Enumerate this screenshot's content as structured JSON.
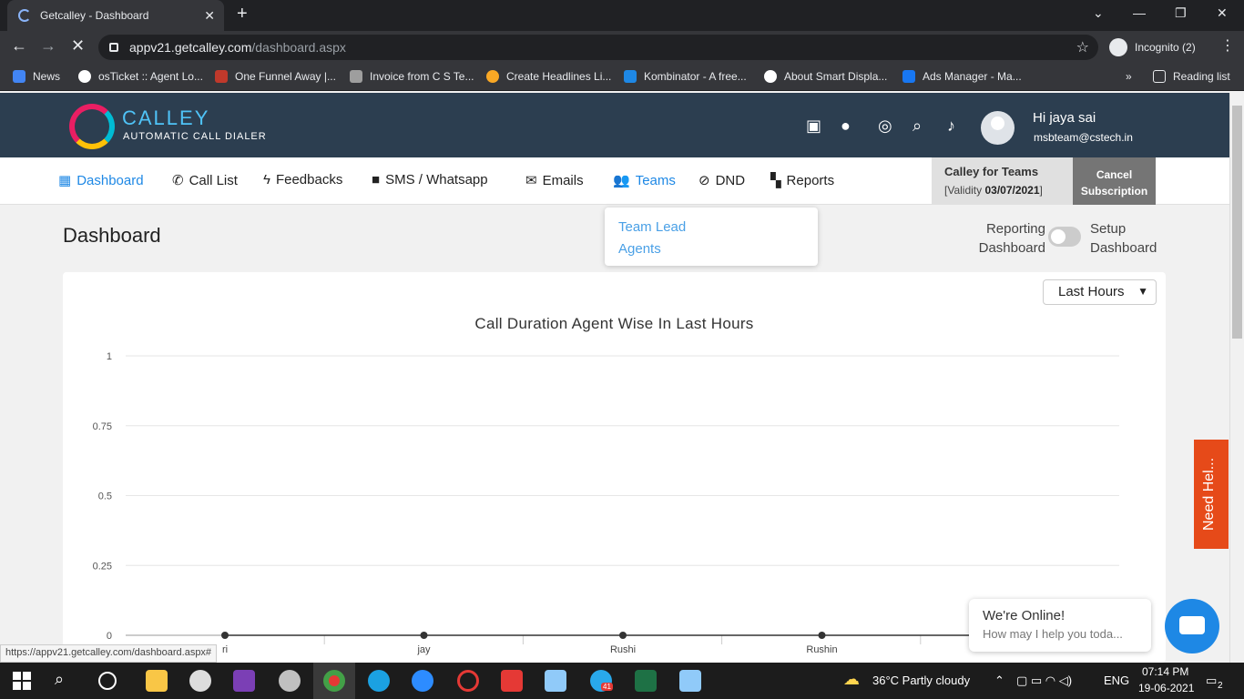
{
  "browser": {
    "tab_title": "Getcalley - Dashboard",
    "tab_close": "✕",
    "new_tab": "+",
    "url_host": "appv21.getcalley.com",
    "url_path": "/dashboard.aspx",
    "incognito_label": "Incognito (2)",
    "status_url": "https://appv21.getcalley.com/dashboard.aspx#"
  },
  "bookmarks": [
    {
      "label": "News",
      "color": "#4285f4"
    },
    {
      "label": "osTicket :: Agent Lo...",
      "color": "#ffffff"
    },
    {
      "label": "One Funnel Away |...",
      "color": "#c0392b"
    },
    {
      "label": "Invoice from C S Te...",
      "color": "#9e9e9e"
    },
    {
      "label": "Create Headlines Li...",
      "color": "#f9a825"
    },
    {
      "label": "Kombinator - A free...",
      "color": "#1e88e5"
    },
    {
      "label": "About Smart Displa...",
      "color": "#ffffff"
    },
    {
      "label": "Ads Manager - Ma...",
      "color": "#1877f2"
    }
  ],
  "bookmarks_more": "»",
  "reading_list": "Reading list",
  "header": {
    "logo_title": "CALLEY",
    "logo_subtitle": "AUTOMATIC CALL DIALER",
    "greeting": "Hi jaya sai",
    "email": "msbteam@cstech.in"
  },
  "nav": {
    "items": [
      {
        "label": "Dashboard",
        "icon": "▦"
      },
      {
        "label": "Call List",
        "icon": "✆"
      },
      {
        "label": "Feedbacks",
        "icon": "ϟ"
      },
      {
        "label": "SMS / Whatsapp",
        "icon": "■"
      },
      {
        "label": "Emails",
        "icon": "✉"
      },
      {
        "label": "Teams",
        "icon": "👥"
      },
      {
        "label": "DND",
        "icon": "⊘"
      },
      {
        "label": "Reports",
        "icon": "▚"
      }
    ],
    "teams_dropdown": [
      "Team Lead",
      "Agents"
    ],
    "plan_name": "Calley for Teams",
    "validity_prefix": "[Validity ",
    "validity_date": "03/07/2021",
    "validity_suffix": "]",
    "cancel_line1": "Cancel",
    "cancel_line2": "Subscription"
  },
  "page": {
    "title": "Dashboard",
    "toggle_left_1": "Reporting",
    "toggle_left_2": "Dashboard",
    "toggle_right_1": "Setup",
    "toggle_right_2": "Dashboard",
    "period_select": "Last Hours"
  },
  "chart_data": {
    "type": "line",
    "title": "Call Duration Agent Wise In Last Hours",
    "categories": [
      "ri",
      "jay",
      "Rushi",
      "Rushin",
      ""
    ],
    "series": [
      {
        "values": [
          0,
          0,
          0,
          0,
          0
        ]
      }
    ],
    "yticks": [
      "1",
      "0.75",
      "0.5",
      "0.25",
      "0"
    ],
    "ylim": [
      0,
      1
    ],
    "grid": true,
    "colors": {
      "line": "#333333",
      "grid": "#e6e6e6",
      "point": "#333333"
    }
  },
  "chat": {
    "need_help": "Need Hel...",
    "online_title": "We're Online!",
    "online_sub": "How may I help you toda..."
  },
  "taskbar": {
    "weather": "36°C  Partly cloudy",
    "lang": "ENG",
    "time": "07:14 PM",
    "date": "19-06-2021",
    "notif_count": "2",
    "telegram_badge": "41"
  }
}
